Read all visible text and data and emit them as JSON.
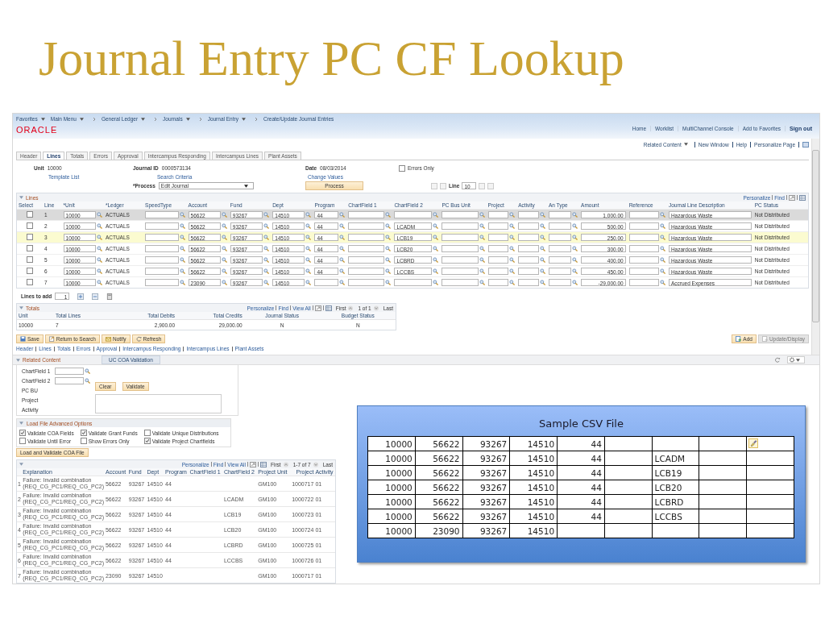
{
  "slide_title": "Journal Entry PC CF Lookup",
  "breadcrumbs": [
    {
      "label": "Favorites",
      "dropdown": true
    },
    {
      "label": "Main Menu",
      "dropdown": true
    },
    {
      "label": "General Ledger",
      "dropdown": true
    },
    {
      "label": "Journals",
      "dropdown": true
    },
    {
      "label": "Journal Entry",
      "dropdown": true
    },
    {
      "label": "Create/Update Journal Entries",
      "dropdown": false
    }
  ],
  "logo": "ORACLE",
  "header_links": [
    "Home",
    "Worklist",
    "MultiChannel Console",
    "Add to Favorites",
    "Sign out"
  ],
  "page_links": [
    {
      "label": "Related Content",
      "dropdown": true
    },
    {
      "label": "New Window",
      "dropdown": false
    },
    {
      "label": "Help",
      "dropdown": false
    },
    {
      "label": "Personalize Page",
      "dropdown": false
    }
  ],
  "tabs": [
    {
      "label": "Header",
      "selected": false
    },
    {
      "label": "Lines",
      "selected": true
    },
    {
      "label": "Totals",
      "selected": false
    },
    {
      "label": "Errors",
      "selected": false
    },
    {
      "label": "Approval",
      "selected": false
    },
    {
      "label": "Intercampus Responding",
      "selected": false
    },
    {
      "label": "Intercampus Lines",
      "selected": false
    },
    {
      "label": "Plant Assets",
      "selected": false
    }
  ],
  "header_form": {
    "unit_label": "Unit",
    "unit": "10000",
    "journal_id_label": "Journal ID",
    "journal_id": "0000573134",
    "date_label": "Date",
    "date": "08/03/2014",
    "errors_only": {
      "label": "Errors Only",
      "checked": false
    },
    "links": [
      "Template List",
      "Search Criteria",
      "Change Values"
    ],
    "process_label": "*Process",
    "process": "Edit Journal",
    "process_button": "Process",
    "line_label": "Line",
    "line": "10"
  },
  "lines": {
    "title": "Lines",
    "tools": [
      "Personalize",
      "Find"
    ],
    "columns": [
      "Select",
      "Line",
      "*Unit",
      "*Ledger",
      "SpeedType",
      "Account",
      "Fund",
      "Dept",
      "Program",
      "ChartField 1",
      "ChartField 2",
      "PC Bus Unit",
      "Project",
      "Activity",
      "An Type",
      "Amount",
      "Reference",
      "Journal Line Description",
      "PC Status"
    ],
    "rows": [
      {
        "line": "1",
        "checked": false,
        "selected": true,
        "highlighted": false,
        "unit": "10000",
        "ledger": "ACTUALS",
        "account": "56622",
        "fund": "93267",
        "dept": "14510",
        "program": "44",
        "amount": "1,000.00",
        "description": "Hazardous Waste",
        "status": "Not Distributed"
      },
      {
        "line": "2",
        "checked": false,
        "selected": false,
        "highlighted": false,
        "unit": "10000",
        "ledger": "ACTUALS",
        "account": "56622",
        "fund": "93267",
        "dept": "14510",
        "program": "44",
        "chartfield_2": "LCADM",
        "amount": "500.00",
        "description": "Hazardous Waste",
        "status": "Not Distributed"
      },
      {
        "line": "3",
        "checked": false,
        "selected": false,
        "highlighted": true,
        "unit": "10000",
        "ledger": "ACTUALS",
        "account": "56622",
        "fund": "93267",
        "dept": "14510",
        "program": "44",
        "chartfield_2": "LCB19",
        "amount": "250.00",
        "description": "Hazardous Waste",
        "status": "Not Distributed"
      },
      {
        "line": "4",
        "checked": false,
        "selected": false,
        "highlighted": false,
        "unit": "10000",
        "ledger": "ACTUALS",
        "account": "56622",
        "fund": "93267",
        "dept": "14510",
        "program": "44",
        "chartfield_2": "LCB20",
        "amount": "300.00",
        "description": "Hazardous Waste",
        "status": "Not Distributed"
      },
      {
        "line": "5",
        "checked": false,
        "selected": false,
        "highlighted": false,
        "unit": "10000",
        "ledger": "ACTUALS",
        "account": "56622",
        "fund": "93267",
        "dept": "14510",
        "program": "44",
        "chartfield_2": "LCBRD",
        "amount": "400.00",
        "description": "Hazardous Waste",
        "status": "Not Distributed"
      },
      {
        "line": "6",
        "checked": false,
        "selected": false,
        "highlighted": false,
        "unit": "10000",
        "ledger": "ACTUALS",
        "account": "56622",
        "fund": "93267",
        "dept": "14510",
        "program": "44",
        "chartfield_2": "LCCBS",
        "amount": "450.00",
        "description": "Hazardous Waste",
        "status": "Not Distributed"
      },
      {
        "line": "7",
        "checked": false,
        "selected": false,
        "highlighted": false,
        "unit": "10000",
        "ledger": "ACTUALS",
        "account": "23090",
        "fund": "93267",
        "dept": "14510",
        "amount": "-29,000.00",
        "description": "Accrued Expenses",
        "status": "Not Distributed"
      }
    ],
    "lines_to_add_label": "Lines to add",
    "lines_to_add": "1"
  },
  "totals": {
    "title": "Totals",
    "tools": [
      "Personalize",
      "Find",
      "View All"
    ],
    "first": "First",
    "count": "1 of 1",
    "last": "Last",
    "columns": [
      "Unit",
      "Total Lines",
      "Total Debits",
      "Total Credits",
      "Journal Status",
      "Budget Status"
    ],
    "rows": [
      [
        "10000",
        "7",
        "2,900.00",
        "29,000.00",
        "N",
        "N"
      ]
    ]
  },
  "buttons": [
    {
      "label": "Save",
      "disabled": false
    },
    {
      "label": "Return to Search",
      "disabled": false
    },
    {
      "label": "Notify",
      "disabled": false
    },
    {
      "label": "Refresh",
      "disabled": false
    }
  ],
  "right_buttons": [
    {
      "label": "Add",
      "disabled": false
    },
    {
      "label": "Update/Display",
      "disabled": true
    }
  ],
  "footer_links": [
    "Header",
    "Lines",
    "Totals",
    "Errors",
    "Approval",
    "Intercampus Responding",
    "Intercampus Lines",
    "Plant Assets"
  ],
  "related": {
    "header": "Related Content",
    "tabs": [
      {
        "label": "UC COA Validation",
        "selected": true
      }
    ],
    "fields": [
      {
        "label": "ChartField 1",
        "kind": "lookup"
      },
      {
        "label": "ChartField 2",
        "kind": "lookup"
      },
      {
        "label": "PC BU",
        "kind": "label"
      },
      {
        "label": "Project",
        "kind": "label"
      },
      {
        "label": "Activity",
        "kind": "label"
      }
    ],
    "buttons": [
      "Clear",
      "Validate"
    ]
  },
  "advanced": {
    "title": "Load File Advanced Options",
    "options": [
      {
        "label": "Validate COA Fields",
        "checked": true
      },
      {
        "label": "Validate Grant Funds",
        "checked": true
      },
      {
        "label": "Validate Unique Distributions",
        "checked": false
      },
      {
        "label": "Validate Until Error",
        "checked": false
      },
      {
        "label": "Show Errors Only",
        "checked": false
      },
      {
        "label": "Validate Project Chartfields",
        "checked": true
      }
    ],
    "button": "Load and Validate COA File"
  },
  "results": {
    "tools": [
      "Personalize",
      "Find",
      "View All"
    ],
    "first": "First",
    "count": "1-7 of 7",
    "last": "Last",
    "columns": [
      "Explanation",
      "Account",
      "Fund",
      "Dept",
      "Program",
      "ChartField 1",
      "ChartField 2",
      "Project Unit",
      "Project",
      "Activity"
    ],
    "rows": [
      {
        "num": "1",
        "explanation": "Failure: Invalid combination (REQ_CG_PC1/REQ_CG_PC2)",
        "account": "56622",
        "fund": "93267",
        "dept": "14510",
        "program": "44",
        "project_unit": "GM100",
        "project": "1000717",
        "activity": "01"
      },
      {
        "num": "2",
        "explanation": "Failure: Invalid combination (REQ_CG_PC1/REQ_CG_PC2)",
        "account": "56622",
        "fund": "93267",
        "dept": "14510",
        "program": "44",
        "chartfield_2": "LCADM",
        "project_unit": "GM100",
        "project": "1000722",
        "activity": "01"
      },
      {
        "num": "3",
        "explanation": "Failure: Invalid combination (REQ_CG_PC1/REQ_CG_PC2)",
        "account": "56622",
        "fund": "93267",
        "dept": "14510",
        "program": "44",
        "chartfield_2": "LCB19",
        "project_unit": "GM100",
        "project": "1000723",
        "activity": "01"
      },
      {
        "num": "4",
        "explanation": "Failure: Invalid combination (REQ_CG_PC1/REQ_CG_PC2)",
        "account": "56622",
        "fund": "93267",
        "dept": "14510",
        "program": "44",
        "chartfield_2": "LCB20",
        "project_unit": "GM100",
        "project": "1000724",
        "activity": "01"
      },
      {
        "num": "5",
        "explanation": "Failure: Invalid combination (REQ_CG_PC1/REQ_CG_PC2)",
        "account": "56622",
        "fund": "93267",
        "dept": "14510",
        "program": "44",
        "chartfield_2": "LCBRD",
        "project_unit": "GM100",
        "project": "1000725",
        "activity": "01"
      },
      {
        "num": "6",
        "explanation": "Failure: Invalid combination (REQ_CG_PC1/REQ_CG_PC2)",
        "account": "56622",
        "fund": "93267",
        "dept": "14510",
        "program": "44",
        "chartfield_2": "LCCBS",
        "project_unit": "GM100",
        "project": "1000726",
        "activity": "01"
      },
      {
        "num": "7",
        "explanation": "Failure: Invalid combination (REQ_CG_PC1/REQ_CG_PC2)",
        "account": "23090",
        "fund": "93267",
        "dept": "14510",
        "project_unit": "GM100",
        "project": "1000717",
        "activity": "01"
      }
    ]
  },
  "csv": {
    "title": "Sample CSV File",
    "rows": [
      {
        "column_1": "10000",
        "column_2": "56622",
        "column_3": "93267",
        "column_4": "14510",
        "column_5": "44"
      },
      {
        "column_1": "10000",
        "column_2": "56622",
        "column_3": "93267",
        "column_4": "14510",
        "column_5": "44",
        "column_7": "LCADM"
      },
      {
        "column_1": "10000",
        "column_2": "56622",
        "column_3": "93267",
        "column_4": "14510",
        "column_5": "44",
        "column_7": "LCB19"
      },
      {
        "column_1": "10000",
        "column_2": "56622",
        "column_3": "93267",
        "column_4": "14510",
        "column_5": "44",
        "column_7": "LCB20"
      },
      {
        "column_1": "10000",
        "column_2": "56622",
        "column_3": "93267",
        "column_4": "14510",
        "column_5": "44",
        "column_7": "LCBRD"
      },
      {
        "column_1": "10000",
        "column_2": "56622",
        "column_3": "93267",
        "column_4": "14510",
        "column_5": "44",
        "column_7": "LCCBS"
      },
      {
        "column_1": "10000",
        "column_2": "23090",
        "column_3": "93267",
        "column_4": "14510"
      }
    ]
  }
}
